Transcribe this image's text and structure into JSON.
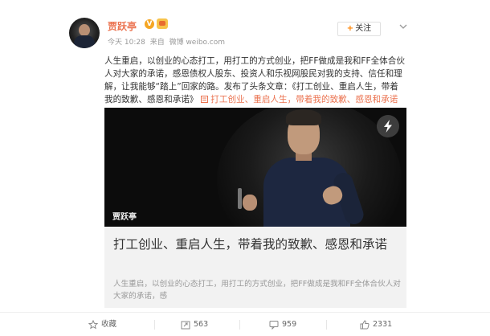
{
  "user": {
    "name": "贾跃亭",
    "verified_icon": "verified-v-icon",
    "member_icon": "crown-member-icon"
  },
  "meta": {
    "time": "今天 10:28",
    "source_prefix": "来自",
    "source": "微博 weibo.com"
  },
  "follow_button": {
    "plus": "+",
    "label": "关注"
  },
  "post": {
    "text": "人生重启，以创业的心态打工，用打工的方式创业，把FF做成是我和FF全体合伙人对大家的承诺，感恩债权人股东、投资人和乐视网股民对我的支持、信任和理解，让我能够“踏上”回家的路。发布了头条文章：《打工创业、重启人生，带着我的致歉、感恩和承诺》",
    "link": "打工创业、重启人生，带着我的致歉、感恩和承诺"
  },
  "card": {
    "watermark": "贾跃亭",
    "title": "打工创业、重启人生，带着我的致歉、感恩和承诺",
    "description": "人生重启，以创业的心态打工，用打工的方式创业，把FF做成是我和FF全体合伙人对大家的承诺，感"
  },
  "actions": {
    "favorite": "收藏",
    "repost": "563",
    "comment": "959",
    "like": "2331"
  },
  "colors": {
    "name_orange": "#eb7350",
    "link_orange": "#eb7350",
    "follow_plus": "#ff8200",
    "card_bg": "#f2f2f2"
  }
}
